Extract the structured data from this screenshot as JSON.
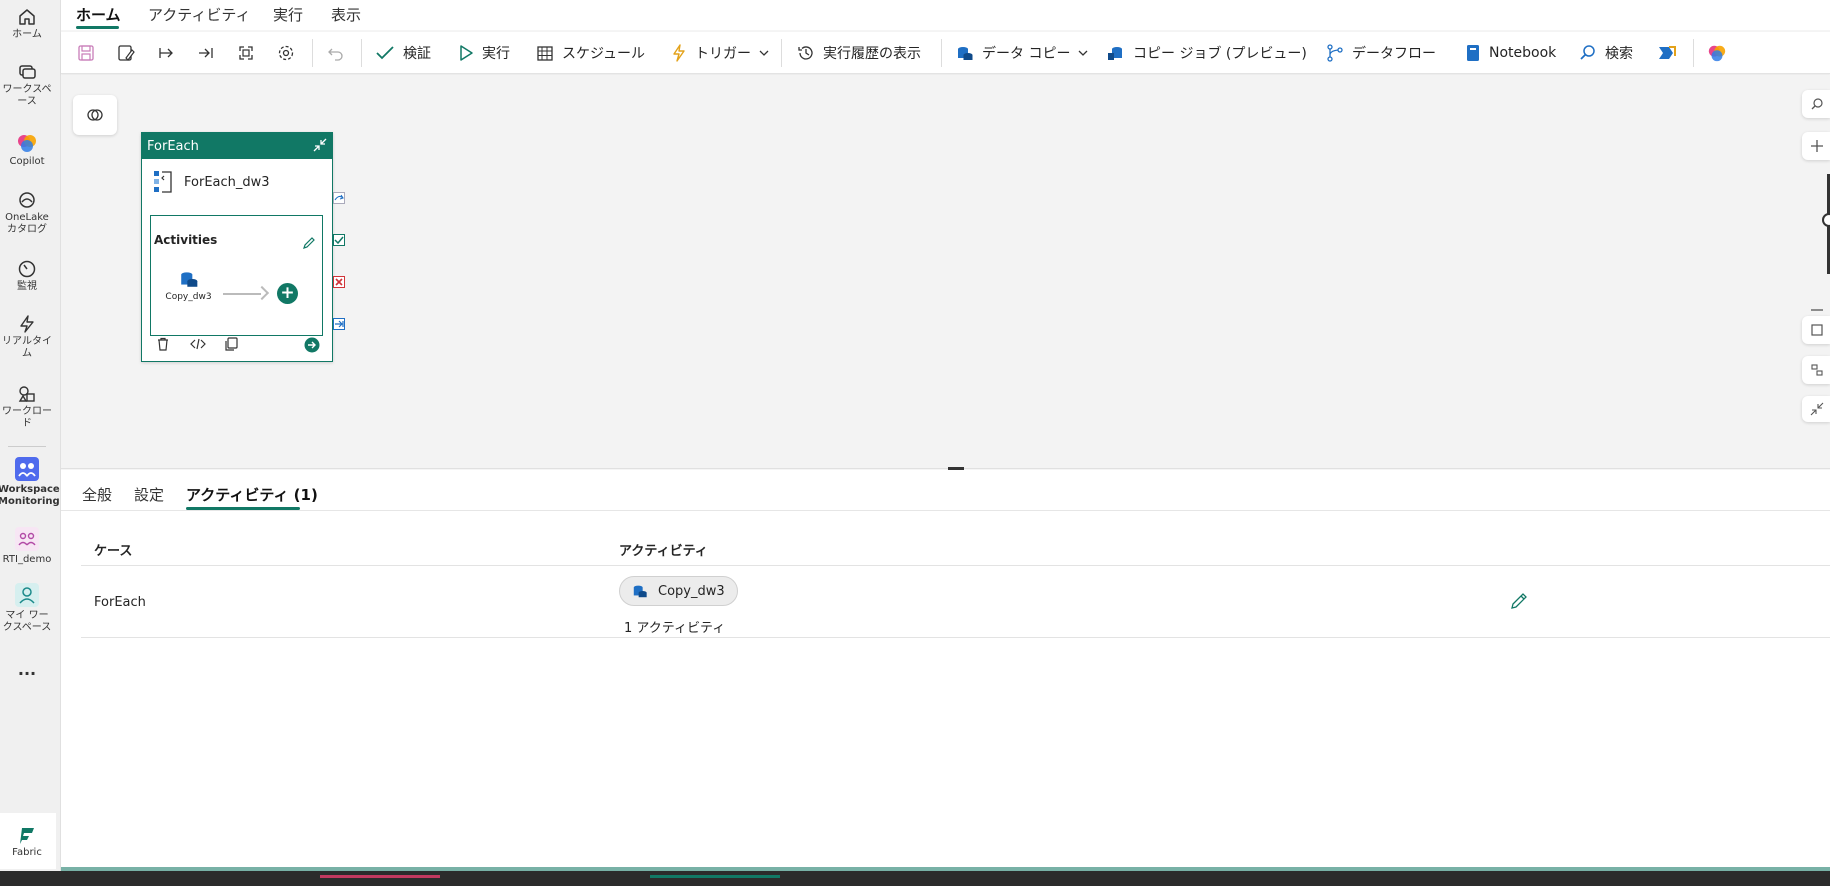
{
  "rail": {
    "items": [
      {
        "label": "ホーム",
        "icon": "home-icon"
      },
      {
        "label": "ワークスペース",
        "icon": "workspaces-icon"
      },
      {
        "label": "Copilot",
        "icon": "copilot-icon"
      },
      {
        "label": "OneLake カタログ",
        "icon": "onelake-icon"
      },
      {
        "label": "監視",
        "icon": "monitor-icon"
      },
      {
        "label": "リアルタイム",
        "icon": "lightning-icon"
      },
      {
        "label": "ワークロード",
        "icon": "workload-icon"
      },
      {
        "label": "Workspace Monitoring",
        "icon": "workspace-monitoring-icon"
      },
      {
        "label": "RTI_demo",
        "icon": "rti-demo-icon"
      },
      {
        "label": "マイ ワークスペース",
        "icon": "my-workspace-icon"
      }
    ],
    "more": "...",
    "fabric": "Fabric"
  },
  "ribbon": {
    "tabs": [
      "ホーム",
      "アクティビティ",
      "実行",
      "表示"
    ]
  },
  "toolbar": {
    "validate": "検証",
    "run": "実行",
    "schedule": "スケジュール",
    "trigger": "トリガー",
    "history": "実行履歴の表示",
    "copy_data": "データ コピー",
    "copy_job": "コピー ジョブ (プレビュー)",
    "dataflow": "データフロー",
    "notebook": "Notebook",
    "search": "検索"
  },
  "canvas": {
    "foreach": {
      "header": "ForEach",
      "name": "ForEach_dw3",
      "activities_title": "Activities",
      "inner_activity": "Copy_dw3"
    }
  },
  "panel": {
    "tabs": [
      "全般",
      "設定",
      "アクティビティ (1)"
    ],
    "columns": [
      "ケース",
      "アクティビティ"
    ],
    "rows": [
      {
        "case": "ForEach",
        "activity": "Copy_dw3",
        "count": "1 アクティビティ"
      }
    ]
  },
  "colors": {
    "accent": "#117865",
    "fail": "#d13438",
    "copy_blue": "#1f6fc4"
  }
}
